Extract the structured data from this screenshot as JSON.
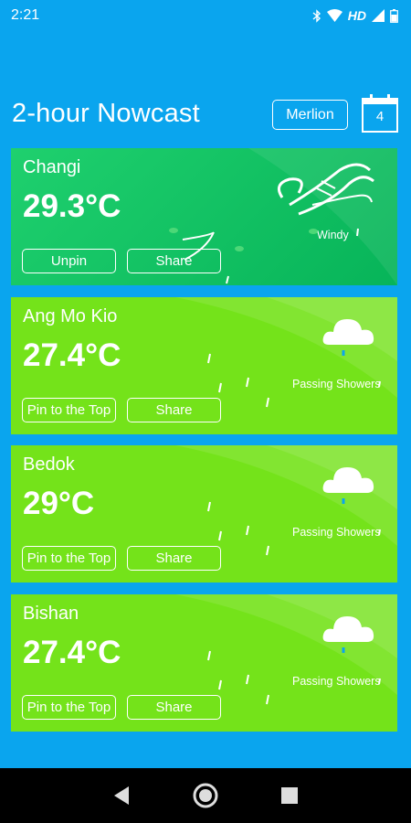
{
  "status_bar": {
    "time": "2:21",
    "network_label": "HD"
  },
  "header": {
    "title": "2-hour Nowcast",
    "mode_button": "Merlion",
    "calendar_day": "4"
  },
  "cards": [
    {
      "name": "Changi",
      "temperature": "29.3°C",
      "pin_label": "Unpin",
      "share_label": "Share",
      "condition": "Windy",
      "icon": "wind-icon"
    },
    {
      "name": "Ang Mo Kio",
      "temperature": "27.4°C",
      "pin_label": "Pin to the Top",
      "share_label": "Share",
      "condition": "Passing Showers",
      "icon": "rain-cloud-icon"
    },
    {
      "name": "Bedok",
      "temperature": "29°C",
      "pin_label": "Pin to the Top",
      "share_label": "Share",
      "condition": "Passing Showers",
      "icon": "rain-cloud-icon"
    },
    {
      "name": "Bishan",
      "temperature": "27.4°C",
      "pin_label": "Pin to the Top",
      "share_label": "Share",
      "condition": "Passing Showers",
      "icon": "rain-cloud-icon"
    }
  ],
  "colors": {
    "background": "#0aa5ee",
    "changi_card": "#09b85b",
    "showers_card": "#74e31a"
  }
}
